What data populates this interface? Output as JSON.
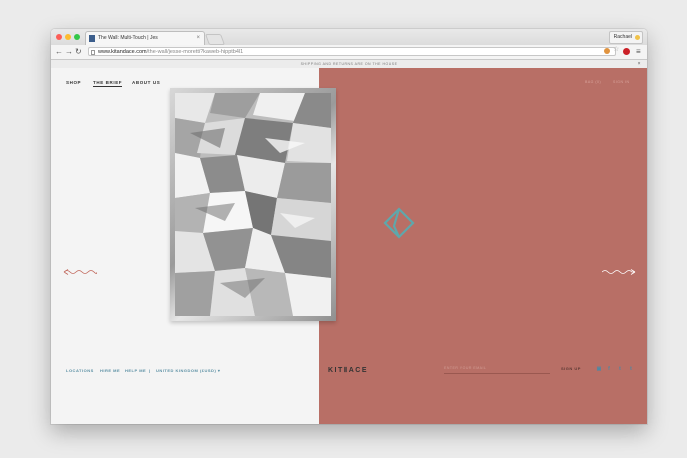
{
  "browser": {
    "tab_title": "The Wall: Multi-Touch | Jes",
    "profile_name": "Rachael",
    "url_host": "www.kitandace.com",
    "url_path": "/the-wall/jesse-moretti?kaweb-hipptb4l1",
    "nav": {
      "back": "←",
      "forward": "→",
      "reload": "↻",
      "menu": "≡"
    }
  },
  "banner": {
    "text": "SHIPPING AND RETURNS ARE ON THE HOUSE",
    "close": "×"
  },
  "nav": {
    "shop": "SHOP",
    "brief": "THE BRIEF",
    "about": "ABOUT US"
  },
  "header_right": {
    "bag": "BAG (0)",
    "sign_in": "SIGN IN"
  },
  "footer": {
    "locations": "LOCATIONS",
    "hire_me": "HIRE ME",
    "help_me": "HELP ME",
    "separator": "|",
    "country": "UNITED KINGDOM (£USD) ▾",
    "logo": "KITⅡACE",
    "email_placeholder": "ENTER YOUR EMAIL",
    "signup": "SIGN UP",
    "social": [
      "instagram-icon",
      "facebook-icon",
      "twitter-icon",
      "tumblr-icon"
    ],
    "social_glyphs": [
      "▣",
      "f",
      "t",
      "t"
    ]
  },
  "colors": {
    "accent_teal": "#5fa7ab",
    "panel_red": "#b86f66",
    "arrow_left": "#c0665a"
  },
  "icons": {
    "arrow_left": "squiggle-arrow-left-icon",
    "arrow_right": "squiggle-arrow-right-icon",
    "center": "kite-logo-icon"
  }
}
